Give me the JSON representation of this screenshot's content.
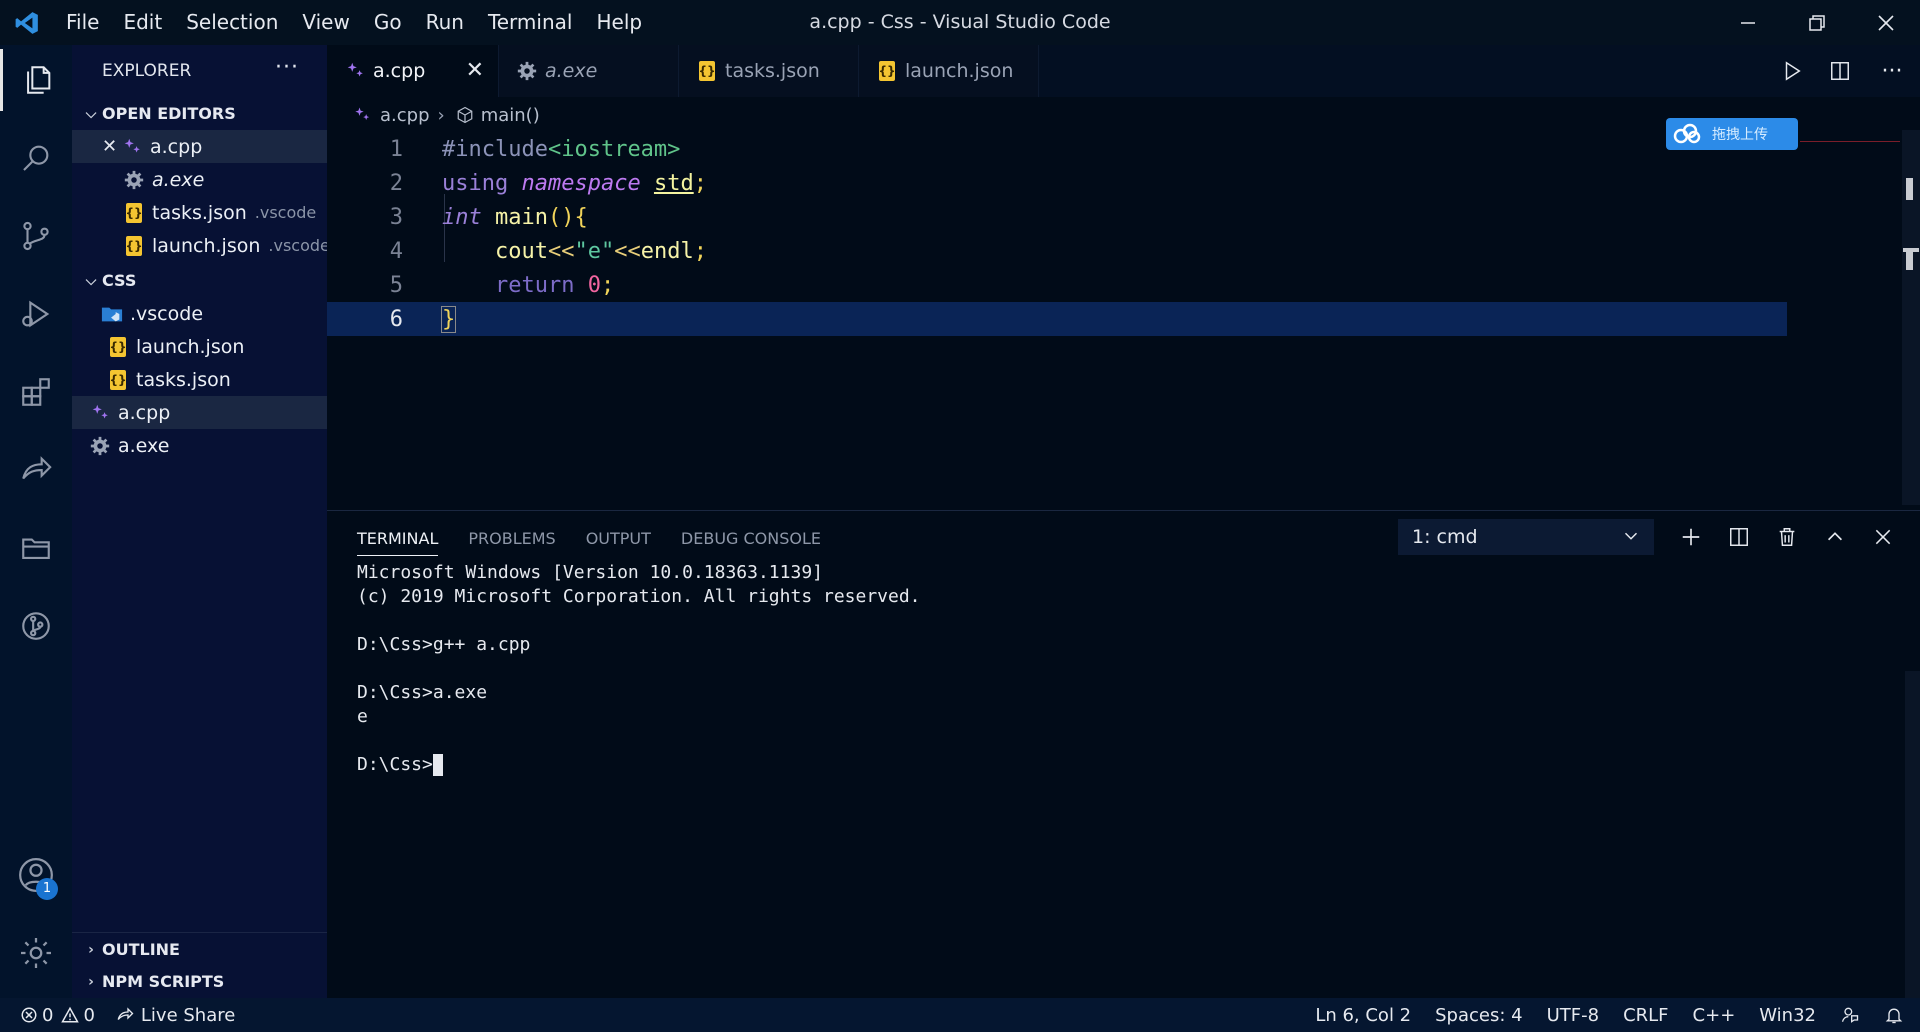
{
  "window": {
    "title": "a.cpp - Css - Visual Studio Code",
    "menu": [
      "File",
      "Edit",
      "Selection",
      "View",
      "Go",
      "Run",
      "Terminal",
      "Help"
    ]
  },
  "activity_bar": {
    "items": [
      "explorer-icon",
      "search-icon",
      "source-control-icon",
      "run-debug-icon",
      "extensions-icon",
      "remote-explorer-icon",
      "folder-icon",
      "git-graph-icon"
    ],
    "accounts_badge": "1"
  },
  "sidebar": {
    "title": "EXPLORER",
    "more": "···",
    "open_editors": {
      "label": "OPEN EDITORS",
      "items": [
        {
          "name": "a.cpp",
          "desc": ""
        },
        {
          "name": "a.exe",
          "desc": ""
        },
        {
          "name": "tasks.json",
          "desc": ".vscode"
        },
        {
          "name": "launch.json",
          "desc": ".vscode"
        }
      ]
    },
    "folder": {
      "label": "CSS",
      "items": [
        ".vscode",
        "launch.json",
        "tasks.json",
        "a.cpp",
        "a.exe"
      ]
    },
    "outline": "OUTLINE",
    "npm": "NPM SCRIPTS"
  },
  "tabs": [
    {
      "label": "a.cpp"
    },
    {
      "label": "a.exe"
    },
    {
      "label": "tasks.json"
    },
    {
      "label": "launch.json"
    }
  ],
  "breadcrumb": {
    "file": "a.cpp",
    "symbol": "main()"
  },
  "editor": {
    "line_numbers": [
      "1",
      "2",
      "3",
      "4",
      "5",
      "6"
    ],
    "l1": {
      "a": "#include",
      "b": "<iostream>"
    },
    "l2": {
      "a": "using",
      "b": "namespace",
      "c": "std",
      "d": ";"
    },
    "l3": {
      "a": "int",
      "b": "main",
      "c": "()",
      "d": "{"
    },
    "l4": {
      "a": "cout",
      "b": "<<",
      "c": "\"e\"",
      "d": "<<",
      "e": "endl",
      "f": ";"
    },
    "l5": {
      "a": "return",
      "b": "0",
      "c": ";"
    },
    "l6": {
      "a": "}"
    }
  },
  "upload_widget": {
    "label": "拖拽上传"
  },
  "panel": {
    "tabs": [
      "TERMINAL",
      "PROBLEMS",
      "OUTPUT",
      "DEBUG CONSOLE"
    ],
    "terminal_select": "1: cmd",
    "lines": [
      "Microsoft Windows [Version 10.0.18363.1139]",
      "(c) 2019 Microsoft Corporation. All rights reserved.",
      "",
      "D:\\Css>g++ a.cpp",
      "",
      "D:\\Css>a.exe",
      "e",
      "",
      "D:\\Css>"
    ]
  },
  "statusbar": {
    "errors": "0",
    "warnings": "0",
    "live_share": "Live Share",
    "position": "Ln 6, Col 2",
    "spaces": "Spaces: 4",
    "encoding": "UTF-8",
    "eol": "CRLF",
    "language": "C++",
    "platform": "Win32"
  },
  "colors": {
    "accent": "#1a74d1",
    "json_icon": "#f4c531",
    "cpp_icon": "#a074f0"
  }
}
